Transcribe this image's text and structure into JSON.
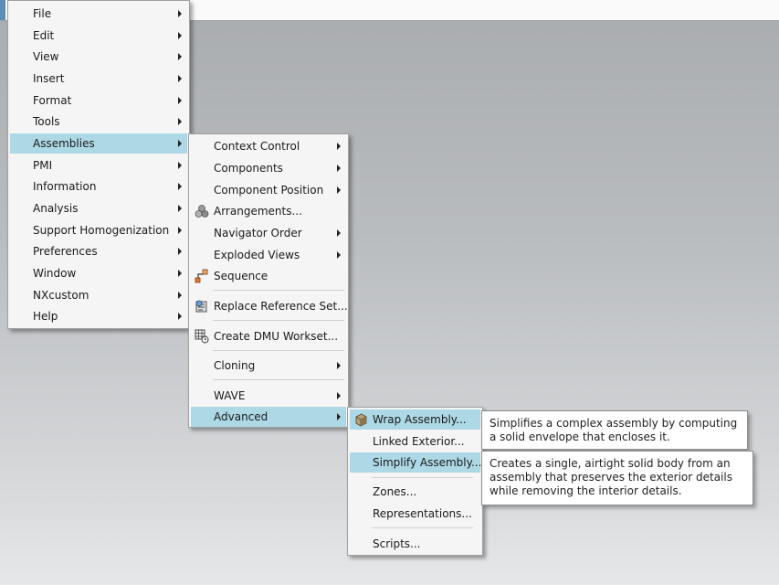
{
  "main_menu": {
    "items": [
      {
        "label": "File"
      },
      {
        "label": "Edit"
      },
      {
        "label": "View"
      },
      {
        "label": "Insert"
      },
      {
        "label": "Format"
      },
      {
        "label": "Tools"
      },
      {
        "label": "Assemblies"
      },
      {
        "label": "PMI"
      },
      {
        "label": "Information"
      },
      {
        "label": "Analysis"
      },
      {
        "label": "Support Homogenization"
      },
      {
        "label": "Preferences"
      },
      {
        "label": "Window"
      },
      {
        "label": "NXcustom"
      },
      {
        "label": "Help"
      }
    ]
  },
  "assemblies_menu": {
    "items": [
      {
        "label": "Context Control"
      },
      {
        "label": "Components"
      },
      {
        "label": "Component Position"
      },
      {
        "label": "Arrangements...",
        "icon": "arrangements-icon"
      },
      {
        "label": "Navigator Order"
      },
      {
        "label": "Exploded Views"
      },
      {
        "label": "Sequence",
        "icon": "sequence-icon"
      },
      {
        "label": "Replace Reference Set...",
        "icon": "replace-reference-set-icon"
      },
      {
        "label": "Create DMU Workset...",
        "icon": "dmu-workset-icon"
      },
      {
        "label": "Cloning"
      },
      {
        "label": "WAVE"
      },
      {
        "label": "Advanced"
      }
    ]
  },
  "advanced_menu": {
    "items": [
      {
        "label": "Wrap Assembly...",
        "icon": "wrap-assembly-icon"
      },
      {
        "label": "Linked Exterior..."
      },
      {
        "label": "Simplify Assembly..."
      },
      {
        "label": "Zones..."
      },
      {
        "label": "Representations..."
      },
      {
        "label": "Scripts..."
      }
    ]
  },
  "tooltips": {
    "wrap_assembly": "Simplifies a complex assembly by computing a solid envelope that encloses it.",
    "simplify_assembly": "Creates a single, airtight solid body from an assembly that preserves the exterior details while removing the interior details."
  },
  "colors": {
    "highlight": "#add8e6",
    "menu_bg": "#f5f5f5"
  }
}
